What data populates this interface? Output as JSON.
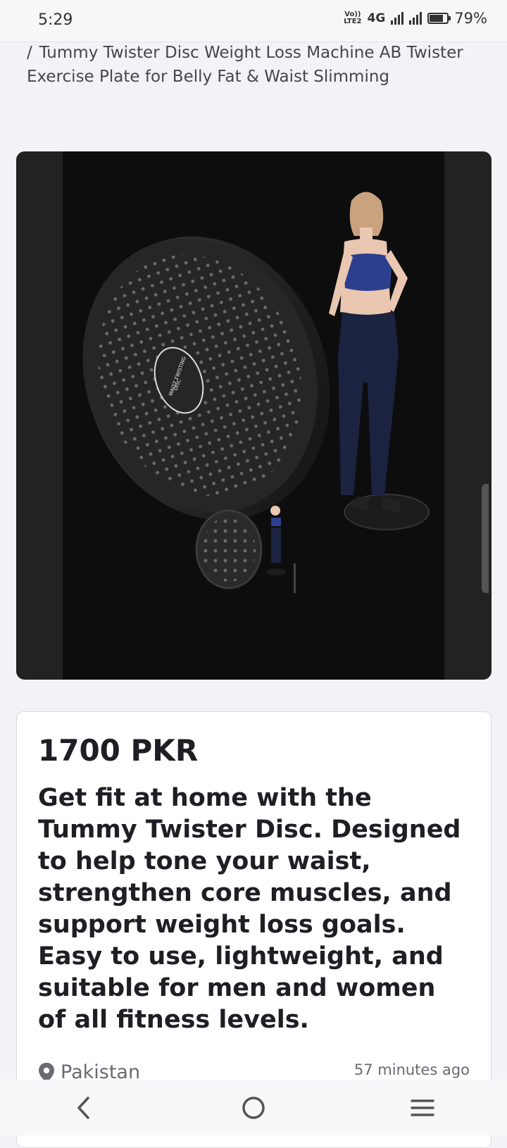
{
  "status_bar": {
    "time": "5:29",
    "volte_line1": "Vo))",
    "volte_line2": "LTE2",
    "network": "4G",
    "battery_percent": "79%",
    "battery_level": 0.79
  },
  "breadcrumb": {
    "separator": "/",
    "current": "Tummy Twister Disc Weight Loss Machine AB Twister Exercise Plate for Belly Fat & Waist Slimming"
  },
  "product_image": {
    "disc_label_top": "WAIST TWISTING",
    "disc_label_bottom": "DISC"
  },
  "listing": {
    "price": "1700 PKR",
    "description": "Get fit at home with the Tummy Twister Disc. Designed to help tone your waist, strengthen core muscles, and support weight loss goals. Easy to use, lightweight, and suitable for men and women of all fitness levels.",
    "location": "Pakistan",
    "posted_time": "57 minutes ago"
  },
  "colors": {
    "background": "#f3f3f7",
    "image_background": "#0d0d0d",
    "text_primary": "#1e1e24",
    "text_secondary": "#6a6a72"
  },
  "icons": [
    "pin-icon",
    "back-icon",
    "home-icon",
    "recents-icon"
  ]
}
